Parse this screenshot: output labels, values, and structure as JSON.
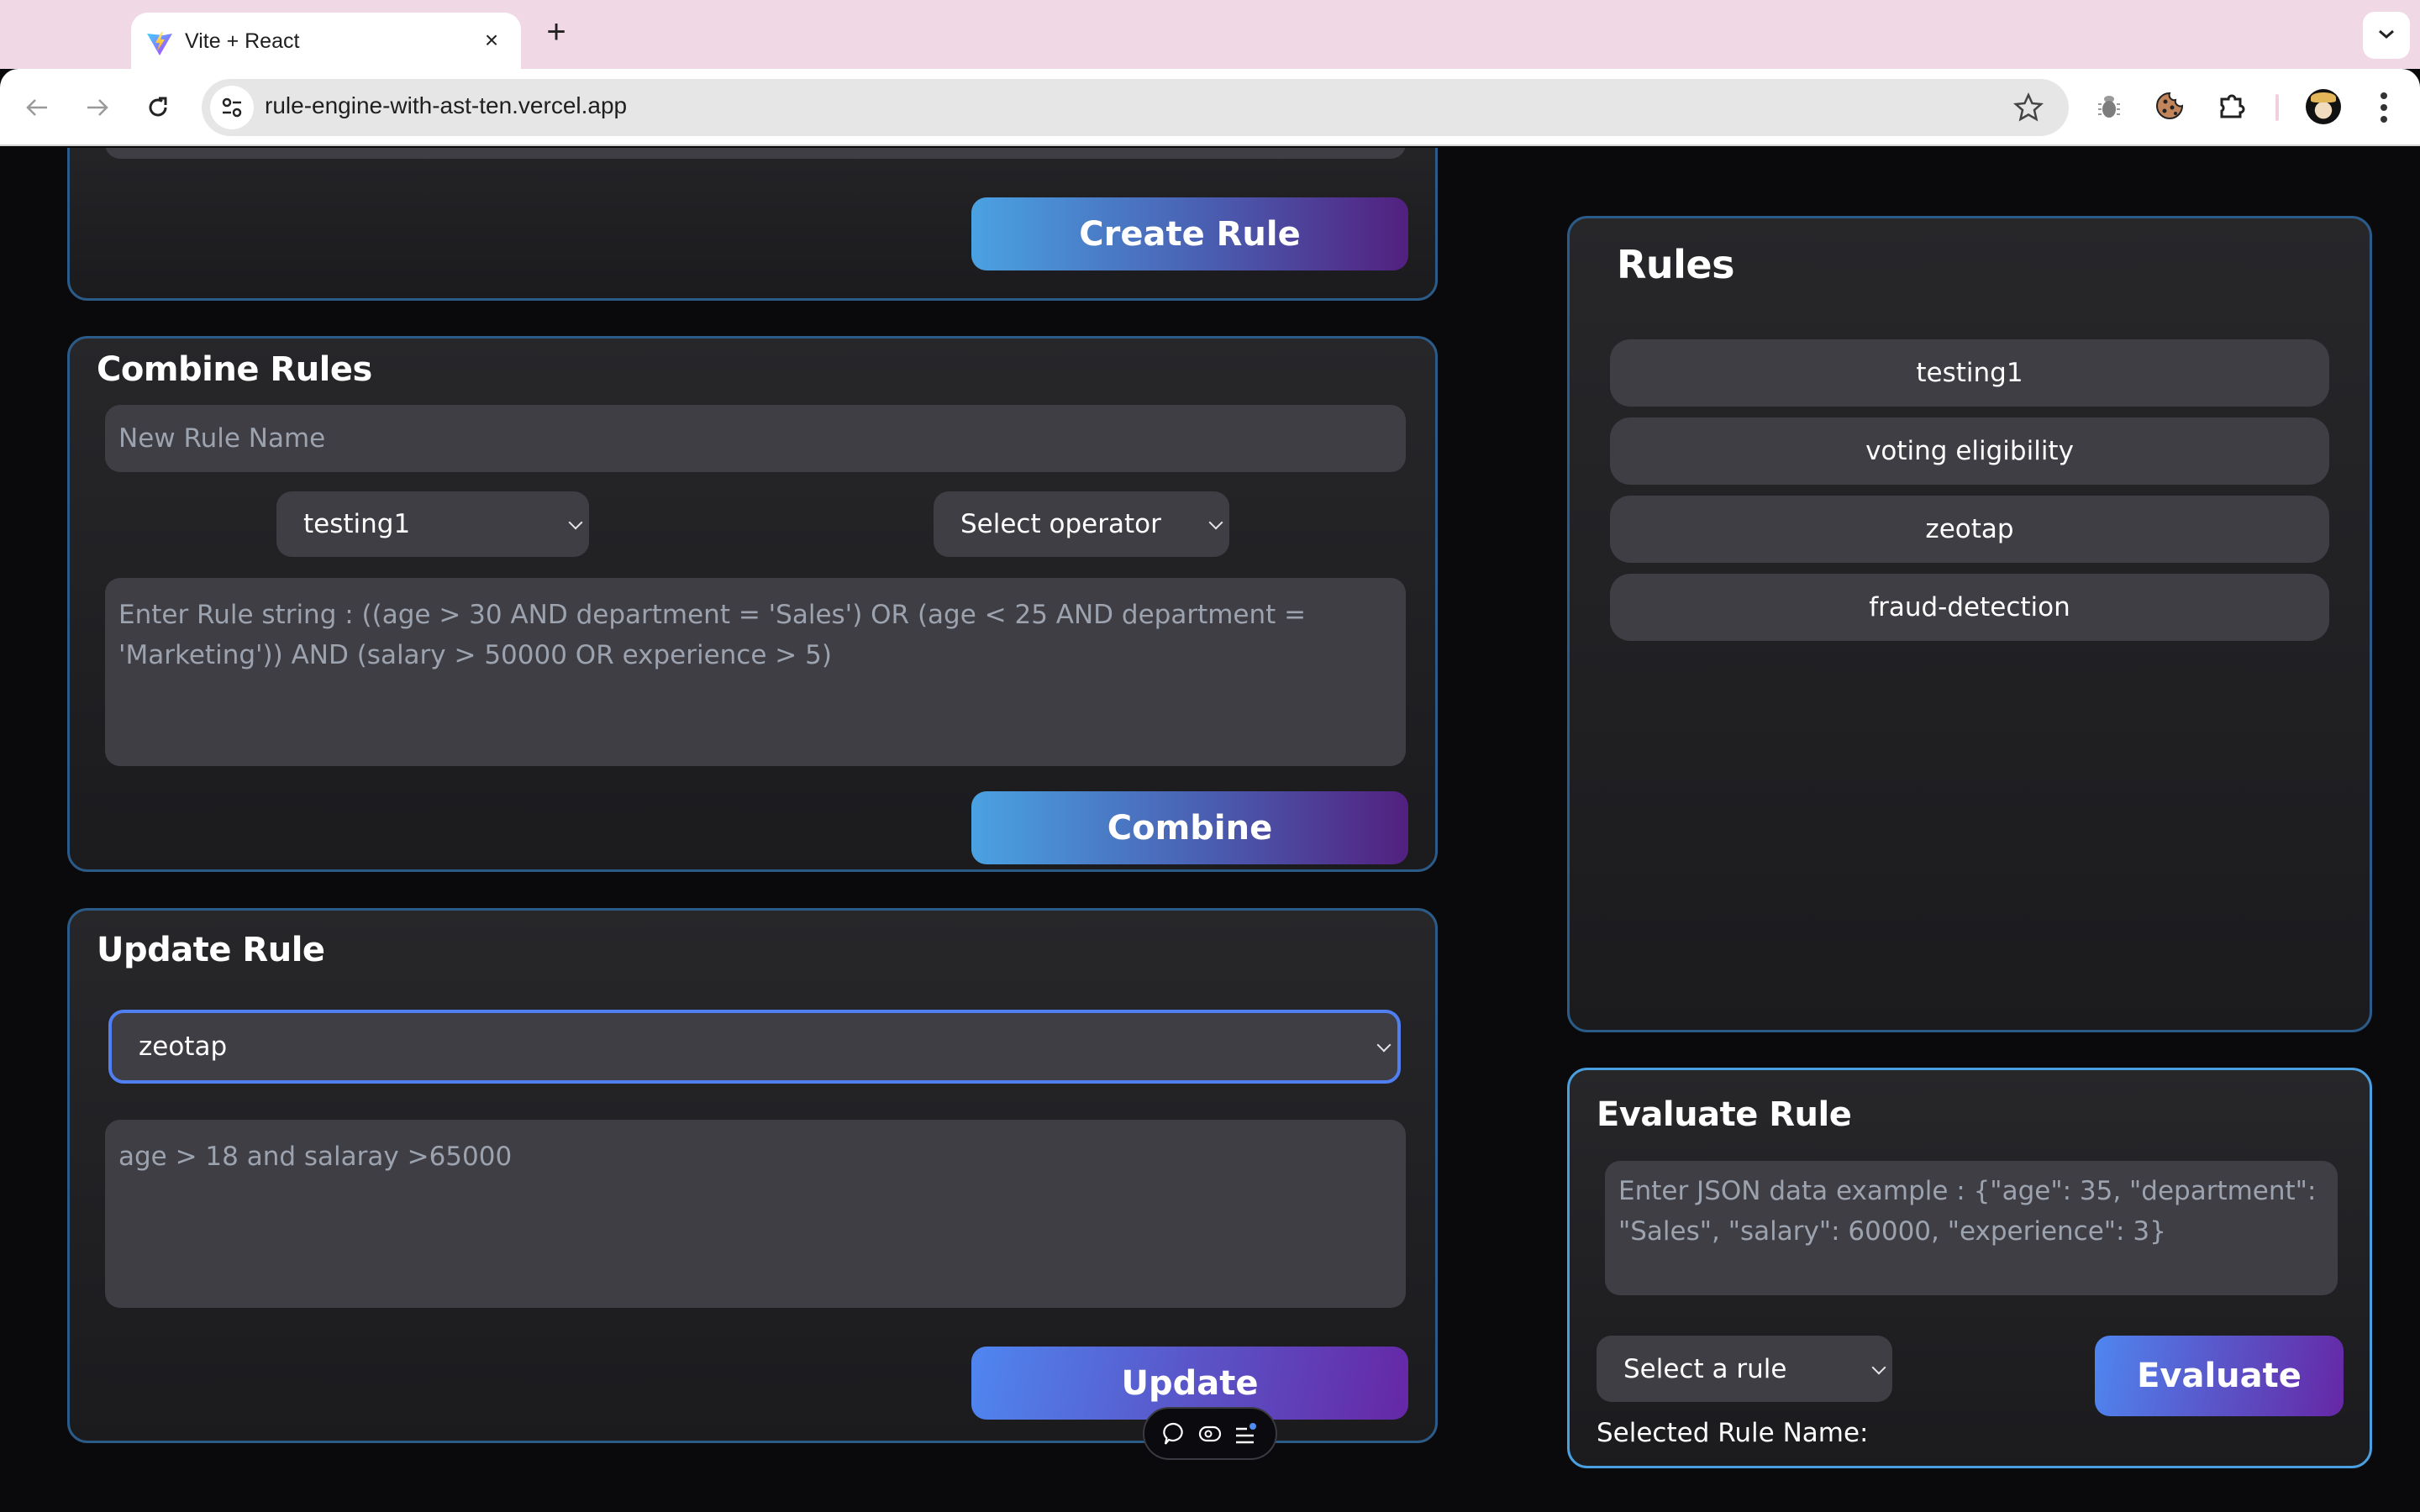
{
  "browser": {
    "tab_title": "Vite + React",
    "tab_close": "×",
    "new_tab": "+",
    "url": "rule-engine-with-ast-ten.vercel.app"
  },
  "create_panel": {
    "button_label": "Create Rule"
  },
  "combine_panel": {
    "title": "Combine Rules",
    "name_placeholder": "New Rule Name",
    "rule_select_value": "testing1",
    "operator_select_value": "Select operator",
    "rule_string_placeholder": "Enter Rule string : ((age > 30 AND department = 'Sales') OR (age < 25 AND department = 'Marketing')) AND (salary > 50000 OR experience > 5)",
    "button_label": "Combine"
  },
  "update_panel": {
    "title": "Update Rule",
    "rule_select_value": "zeotap",
    "rule_text_placeholder": "age > 18 and salaray >65000",
    "button_label": "Update"
  },
  "rules_panel": {
    "title": "Rules",
    "items": [
      {
        "label": "testing1"
      },
      {
        "label": "voting eligibility"
      },
      {
        "label": "zeotap"
      },
      {
        "label": "fraud-detection"
      }
    ]
  },
  "evaluate_panel": {
    "title": "Evaluate Rule",
    "json_placeholder": "Enter JSON data example : {\"age\": 35, \"department\": \"Sales\", \"salary\": 60000, \"experience\": 3}",
    "rule_select_value": "Select a rule",
    "button_label": "Evaluate",
    "selected_rule_label": "Selected Rule Name:"
  },
  "colors": {
    "panel_border": "#2b5b88",
    "panel_border_active": "#4a9fe0",
    "focus_ring": "#4f7ff0",
    "field_bg": "#3f3e45",
    "page_bg": "#0a0a0c",
    "tabstrip_bg": "#f0d8e4"
  }
}
